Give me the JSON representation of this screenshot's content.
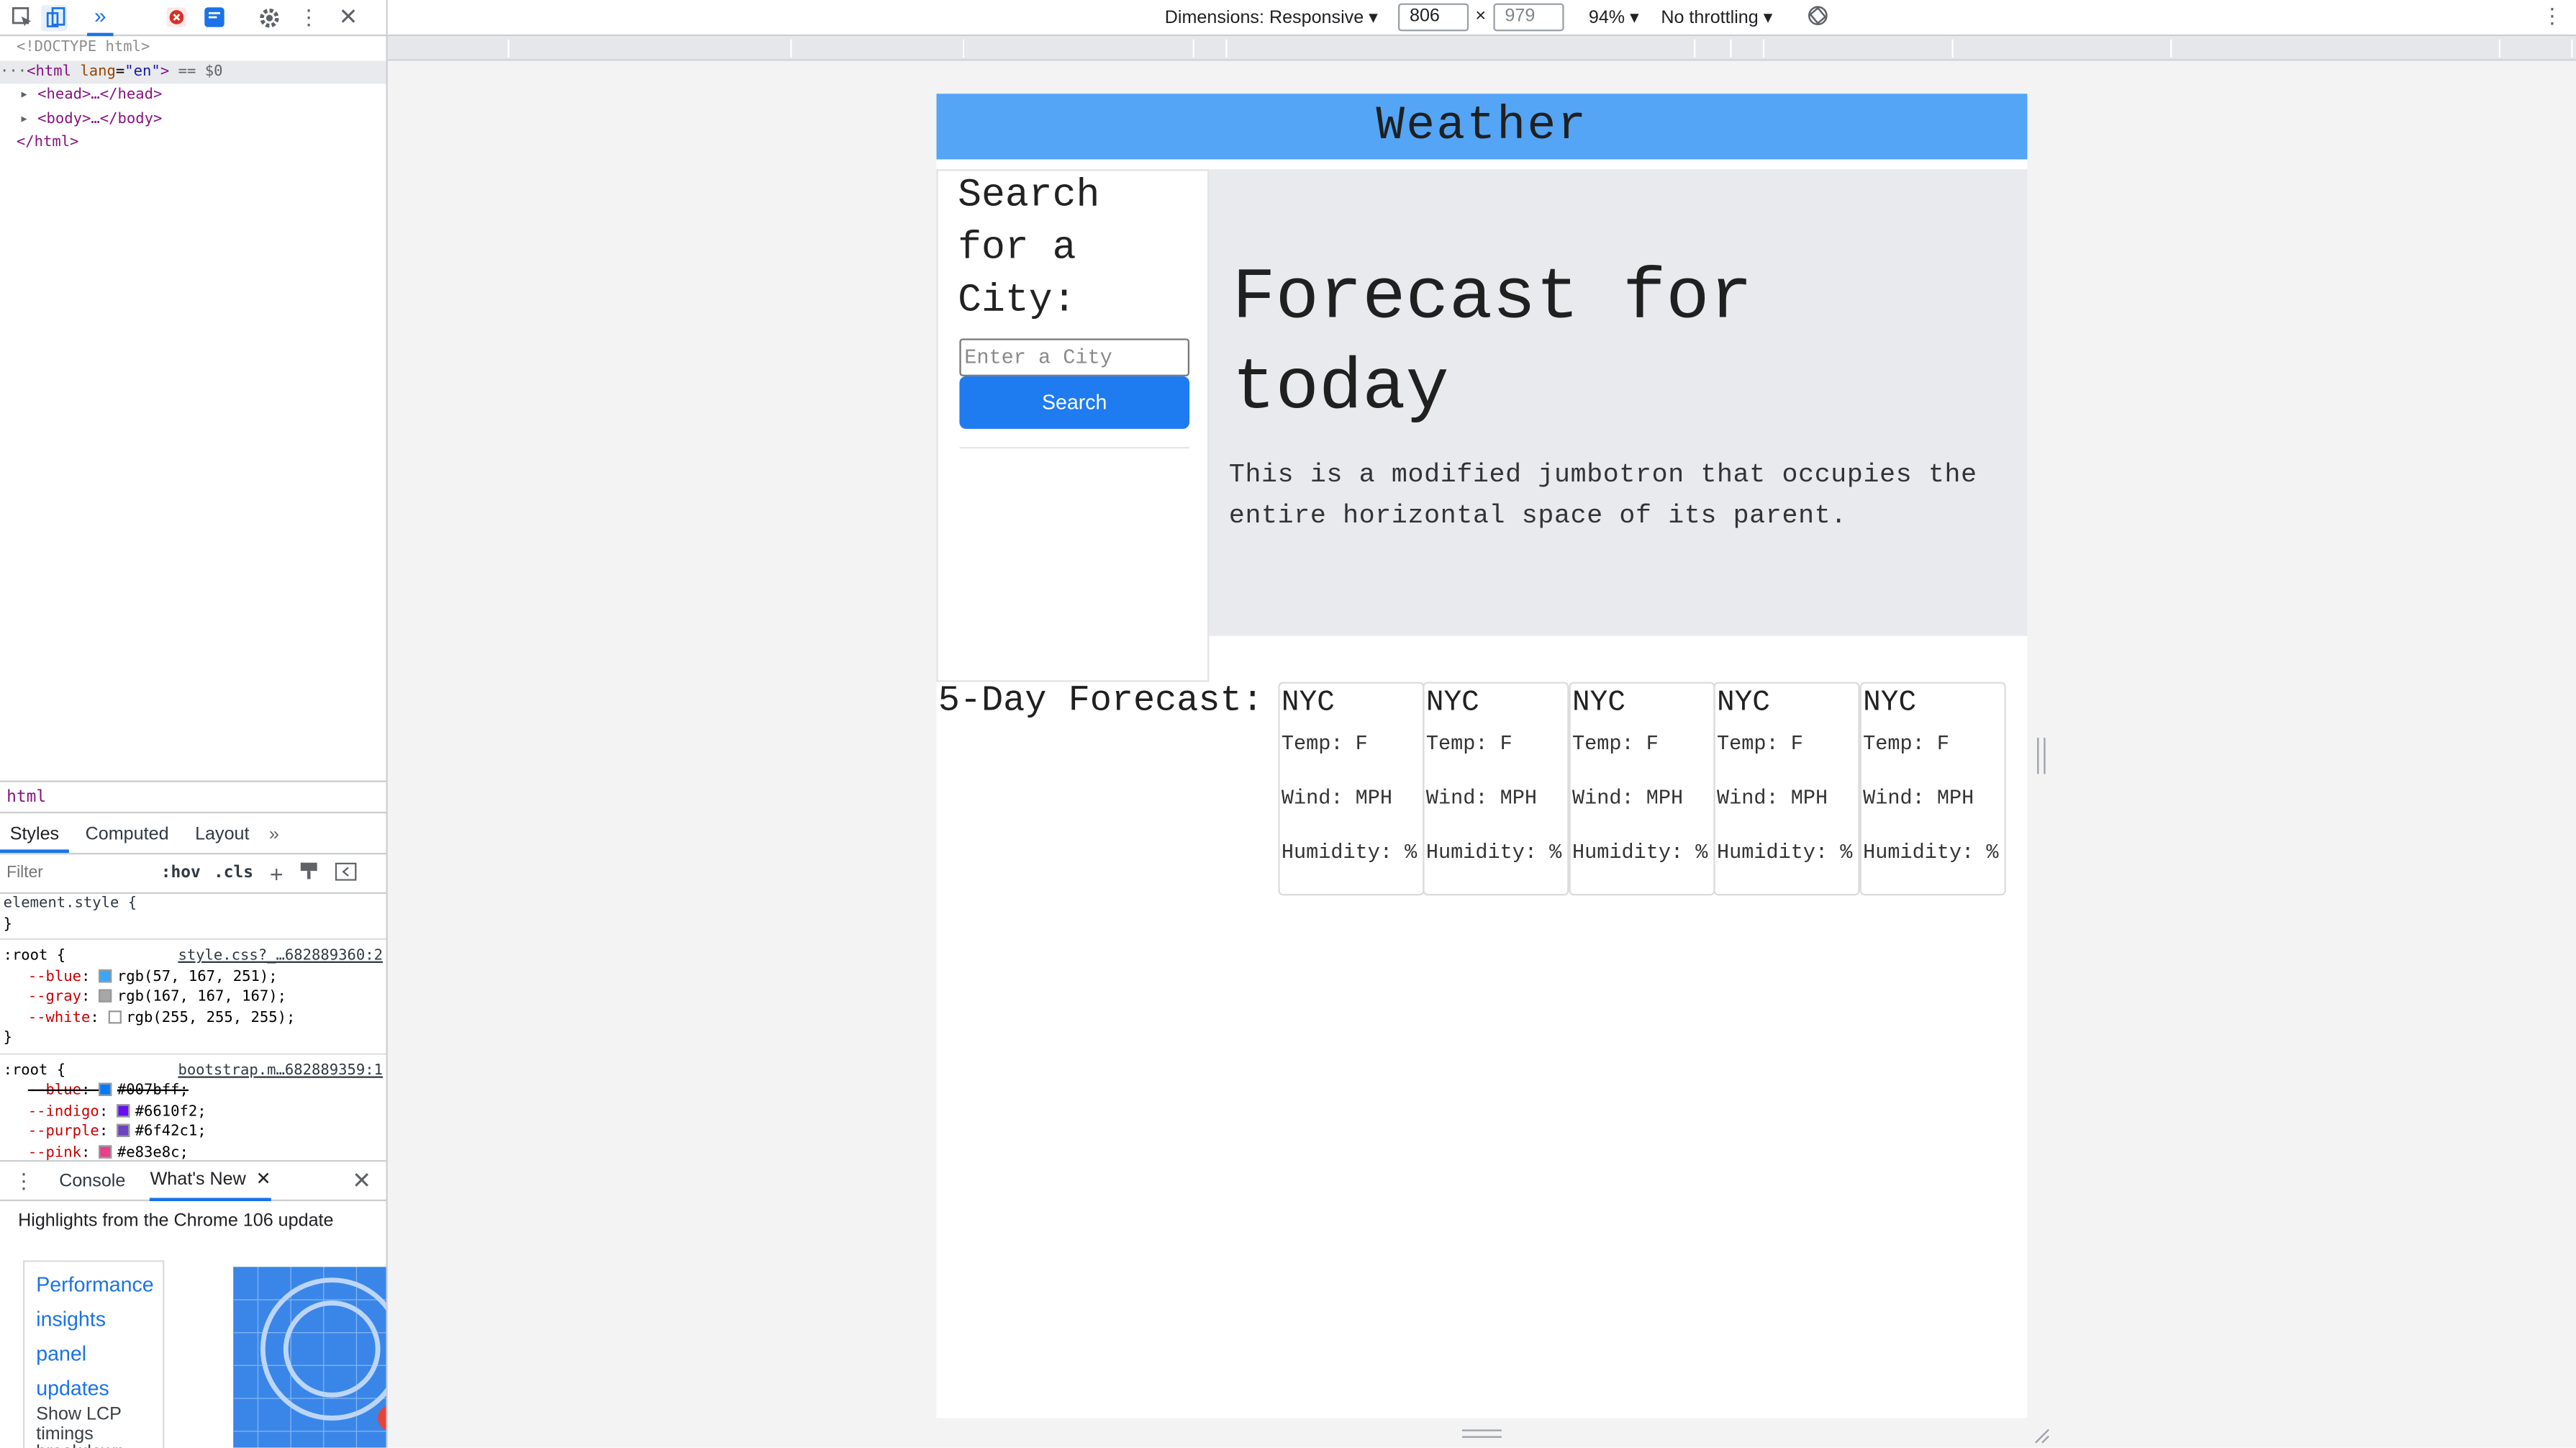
{
  "devtools": {
    "elements": {
      "doctype": "<!DOCTYPE html>",
      "html_open_tag": "html",
      "html_attr": "lang",
      "html_attr_val": "\"en\"",
      "selected_marker": "== $0",
      "head_line": "<head>…</head>",
      "body_line": "<body>…</body>",
      "html_close": "</html>"
    },
    "breadcrumb": "html",
    "style_tabs": [
      "Styles",
      "Computed",
      "Layout"
    ],
    "filter_placeholder": "Filter",
    "hov": ":hov",
    "cls": ".cls",
    "styles": {
      "element_style": "element.style {",
      "close_brace": "}",
      "root1_selector": ":root {",
      "root1_source": "style.css?_…682889360:2",
      "root1_props": [
        {
          "name": "--blue",
          "value": "rgb(57, 167, 251);",
          "color": "#39a7fb"
        },
        {
          "name": "--gray",
          "value": "rgb(167, 167, 167);",
          "color": "#a7a7a7"
        },
        {
          "name": "--white",
          "value": "rgb(255, 255, 255);",
          "color": "#ffffff"
        }
      ],
      "root2_selector": ":root {",
      "root2_source": "bootstrap.m…682889359:1",
      "root2_props": [
        {
          "name": "--blue",
          "value": "#007bff;",
          "color": "#007bff"
        },
        {
          "name": "--indigo",
          "value": "#6610f2;",
          "color": "#6610f2"
        },
        {
          "name": "--purple",
          "value": "#6f42c1;",
          "color": "#6f42c1"
        },
        {
          "name": "--pink",
          "value": "#e83e8c;",
          "color": "#e83e8c"
        }
      ]
    },
    "drawer_tabs": {
      "console": "Console",
      "whats_new": "What's New"
    },
    "drawer_title": "Highlights from the Chrome 106 update",
    "whats_new_links": [
      "Performance",
      "insights",
      "panel",
      "updates"
    ],
    "whats_new_small": "Show LCP timings breakdown"
  },
  "device_toolbar": {
    "dimensions_label": "Dimensions: Responsive",
    "width": "806",
    "height_placeholder": "979",
    "times": "×",
    "zoom": "94%",
    "throttling": "No throttling"
  },
  "page": {
    "header_title": "Weather",
    "sidebar_title": "Search for a City:",
    "search_placeholder": "Enter a City",
    "search_button": "Search",
    "jumbotron_heading": "Forecast for today",
    "jumbotron_text": "This is a modified jumbotron that occupies the entire horizontal space of its parent.",
    "forecast_label": "5-Day Forecast:",
    "forecast_cards": [
      {
        "city": "NYC",
        "temp": "Temp: F",
        "wind": "Wind: MPH",
        "humidity": "Humidity: %"
      },
      {
        "city": "NYC",
        "temp": "Temp: F",
        "wind": "Wind: MPH",
        "humidity": "Humidity: %"
      },
      {
        "city": "NYC",
        "temp": "Temp: F",
        "wind": "Wind: MPH",
        "humidity": "Humidity: %"
      },
      {
        "city": "NYC",
        "temp": "Temp: F",
        "wind": "Wind: MPH",
        "humidity": "Humidity: %"
      },
      {
        "city": "NYC",
        "temp": "Temp: F",
        "wind": "Wind: MPH",
        "humidity": "Humidity: %"
      }
    ]
  },
  "colors": {
    "header_bg": "#54a5f5",
    "jumbotron_bg": "#e9eaed",
    "search_button_bg": "#1e7bf0",
    "devtools_accent": "#1a73e8"
  }
}
